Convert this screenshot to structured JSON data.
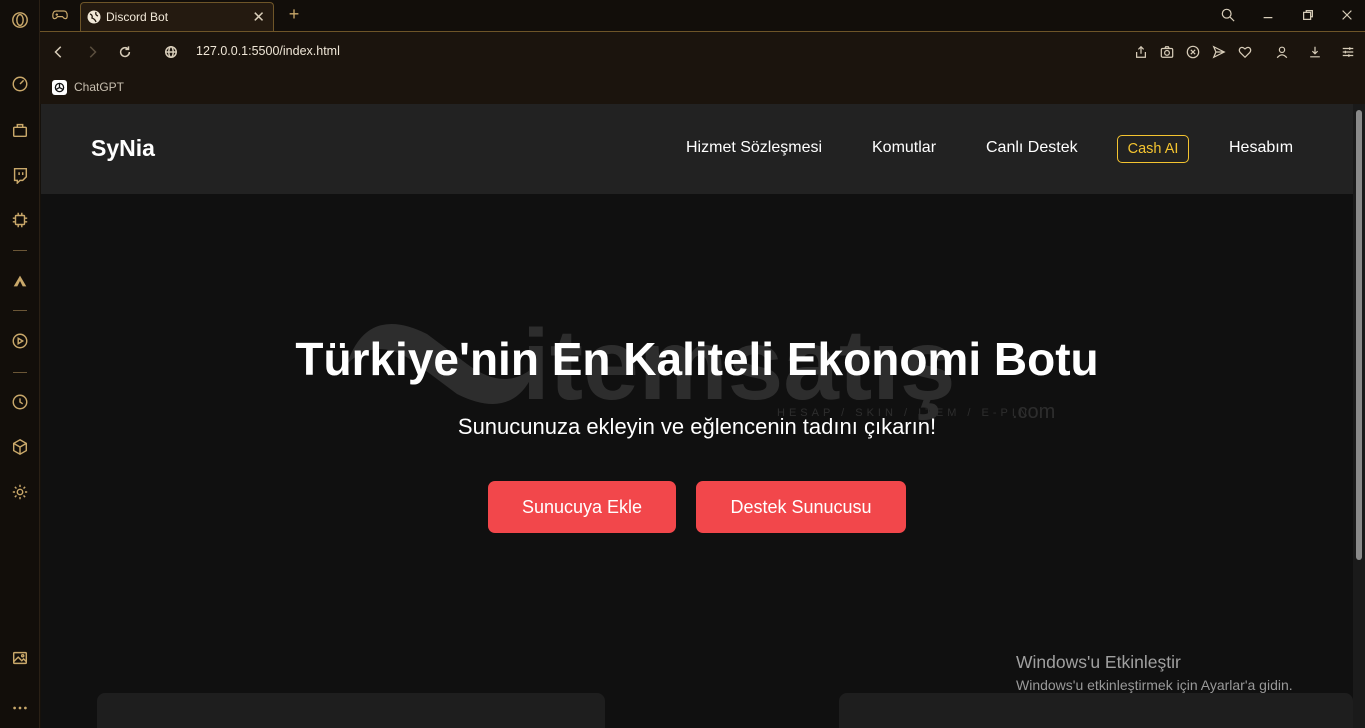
{
  "browser": {
    "tab_title": "Discord Bot",
    "tab_close": "✕",
    "new_tab": "+",
    "url": "127.0.0.1:5500/index.html",
    "bookmarks": [
      {
        "label": "ChatGPT"
      }
    ]
  },
  "site": {
    "logo": "SyNia",
    "nav": {
      "terms": "Hizmet Sözleşmesi",
      "commands": "Komutlar",
      "live_support": "Canlı Destek",
      "cash_ai": "Cash AI",
      "account": "Hesabım"
    },
    "hero": {
      "title": "Türkiye'nin En Kaliteli Ekonomi Botu",
      "subtitle": "Sunucunuza ekleyin ve eğlencenin tadını çıkarın!",
      "add_button": "Sunucuya Ekle",
      "support_button": "Destek Sunucusu"
    },
    "watermark": {
      "brand": "itemsatış",
      "tagline": "HESAP / SKIN / ITEM / E-PIN",
      "suffix": ".com"
    }
  },
  "os_overlay": {
    "title": "Windows'u Etkinleştir",
    "subtitle": "Windows'u etkinleştirmek için Ayarlar'a gidin."
  },
  "colors": {
    "accent_red": "#f2474b",
    "cash_gold": "#f4c430",
    "browser_gold": "#c9a86a"
  }
}
